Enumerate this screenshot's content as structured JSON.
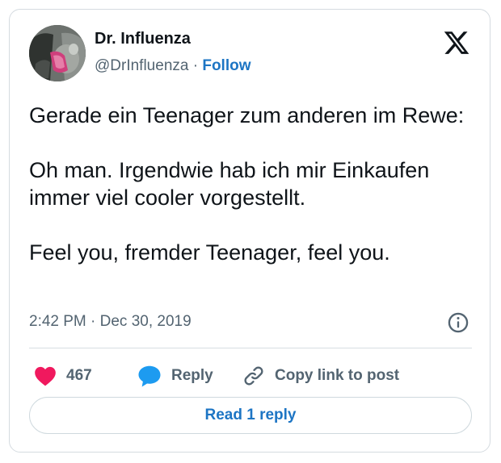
{
  "author": {
    "name": "Dr. Influenza",
    "handle": "@DrInfluenza",
    "separator": " · ",
    "follow_label": "Follow"
  },
  "tweet": {
    "paragraphs": [
      "Gerade ein Teenager zum anderen im Rewe:",
      "Oh man. Irgendwie hab ich mir Einkaufen immer viel cooler vorgestellt.",
      "Feel you, fremder Teenager, feel you."
    ],
    "timestamp": "2:42 PM · Dec 30, 2019"
  },
  "actions": {
    "like_count": "467",
    "reply_label": "Reply",
    "copy_link_label": "Copy link to post"
  },
  "read_replies_label": "Read 1 reply",
  "icons": {
    "platform": "x-logo-icon",
    "info": "info-icon",
    "like": "heart-icon",
    "reply": "speech-bubble-icon",
    "copy": "link-icon"
  },
  "colors": {
    "accent": "#1d75c4",
    "heart": "#f0195e",
    "reply_bubble": "#1d9bf0",
    "muted_text": "#536471",
    "border": "#d5dbe0"
  }
}
